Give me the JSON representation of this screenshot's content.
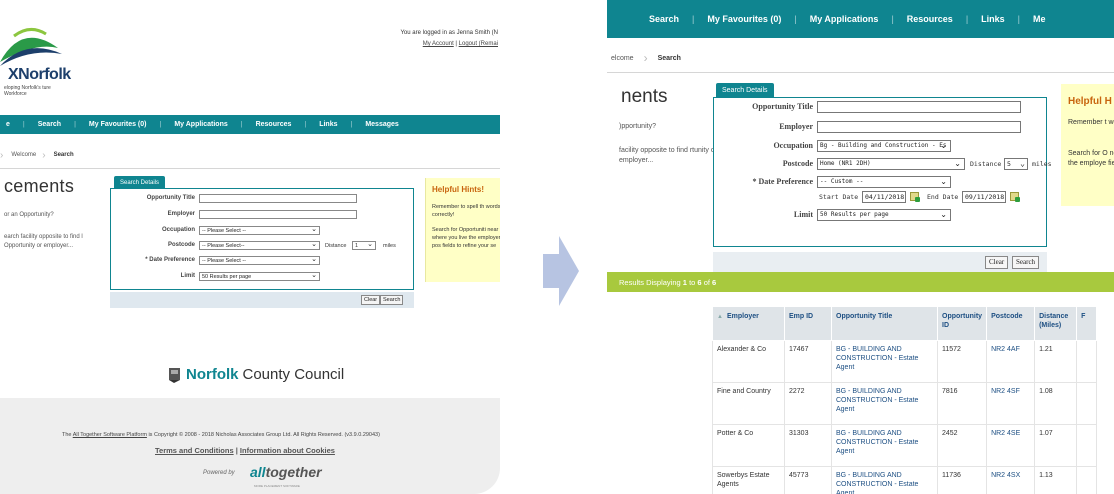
{
  "left": {
    "logo": {
      "brand": "XNorfolk",
      "tagline": "eloping Norfolk's ture Workforce"
    },
    "user": {
      "logged_in_text": "You are logged in as Jenna Smith (N",
      "my_account": "My Account",
      "logout": "Logout (Remai"
    },
    "nav": [
      "e",
      "Search",
      "My Favourites (0)",
      "My Applications",
      "Resources",
      "Links",
      "Messages"
    ],
    "breadcrumb": [
      "Welcome",
      "Search"
    ],
    "heading": "cements",
    "intro": {
      "line1": "or an Opportunity?",
      "line2": "earch facility opposite to find l Opportunity or employer..."
    },
    "form": {
      "tab": "Search Details",
      "labels": {
        "title": "Opportunity Title",
        "employer": "Employer",
        "occupation": "Occupation",
        "postcode": "Postcode",
        "date": "* Date Preference",
        "limit": "Limit"
      },
      "occupation_value": "-- Please Select --",
      "postcode_value": "-- Please Select--",
      "distance_label": "Distance",
      "distance_value": "1",
      "miles": "miles",
      "date_value": "-- Please Select --",
      "limit_value": "50 Results per page",
      "clear": "Clear",
      "search": "Search"
    },
    "hints": {
      "title": "Helpful Hints!",
      "p1": "Remember to spell th words correctly!",
      "p2": "Search for Opportuniti near to where you live the employer and pos fields to refine your se"
    },
    "council": {
      "bold": "Norfolk",
      "rest": "County Council"
    },
    "footer": {
      "copy_pre": "The",
      "copy_link": "All Together Software Platform",
      "copy_post": "is Copyright © 2008 - 2018 Nicholas Associates Group Ltd. All Rights Reserved. (v3.9.0.29043)",
      "terms": "Terms and Conditions",
      "sep": "|",
      "cookies": "Information about Cookies",
      "powered": "Powered by",
      "alltogether_a": "all",
      "alltogether_b": "together",
      "alltogether_sub": "MORE PLACEMENT SOFTWARE"
    }
  },
  "right": {
    "nav": [
      "Search",
      "My Favourites (0)",
      "My Applications",
      "Resources",
      "Links",
      "Me"
    ],
    "breadcrumb": [
      "elcome",
      "Search"
    ],
    "heading": "nents",
    "intro": {
      "line1": ")pportunity?",
      "line2": "facility opposite to find rtunity or employer..."
    },
    "form": {
      "tab": "Search Details",
      "labels": {
        "title": "Opportunity Title",
        "employer": "Employer",
        "occupation": "Occupation",
        "postcode": "Postcode",
        "date": "* Date Preference",
        "limit": "Limit"
      },
      "occupation_value": "Bg - Building and Construction - Es",
      "postcode_value": "Home (NR1 2DH)",
      "distance_label": "Distance",
      "distance_value": "5",
      "miles": "miles",
      "date_value": "-- Custom --",
      "start_label": "Start Date",
      "start_value": "04/11/2018",
      "end_label": "End Date",
      "end_value": "09/11/2018",
      "limit_value": "50 Results per page",
      "clear": "Clear",
      "search": "Search"
    },
    "hints": {
      "title": "Helpful H",
      "p1": "Remember t words corre",
      "p2": "Search for O near to wher the employe fields to refin"
    },
    "results": {
      "prefix": "Results Displaying",
      "from": "1",
      "to_word": "to",
      "to": "6",
      "of_word": "of",
      "total": "6"
    },
    "table": {
      "headers": [
        "Employer",
        "Emp ID",
        "Opportunity Title",
        "Opportunity ID",
        "Postcode",
        "Distance (Miles)",
        "F"
      ],
      "rows": [
        [
          "Alexander & Co",
          "17467",
          "BG - BUILDING AND CONSTRUCTION - Estate Agent",
          "11572",
          "NR2 4AF",
          "1.21"
        ],
        [
          "Fine and Country",
          "2272",
          "BG - BUILDING AND CONSTRUCTION - Estate Agent",
          "7816",
          "NR2 4SF",
          "1.08"
        ],
        [
          "Potter & Co",
          "31303",
          "BG - BUILDING AND CONSTRUCTION - Estate Agent",
          "2452",
          "NR2 4SE",
          "1.07"
        ],
        [
          "Sowerbys Estate Agents",
          "45773",
          "BG - BUILDING AND CONSTRUCTION - Estate Agent",
          "11736",
          "NR2 4SX",
          "1.13"
        ]
      ]
    }
  },
  "colors": {
    "teal": "#0f8590",
    "green_bar": "#a8c93e",
    "hint_bg": "#ffffc6",
    "hint_title": "#c8650f",
    "link": "#1d4f83",
    "arrow": "#b7c4e2"
  }
}
